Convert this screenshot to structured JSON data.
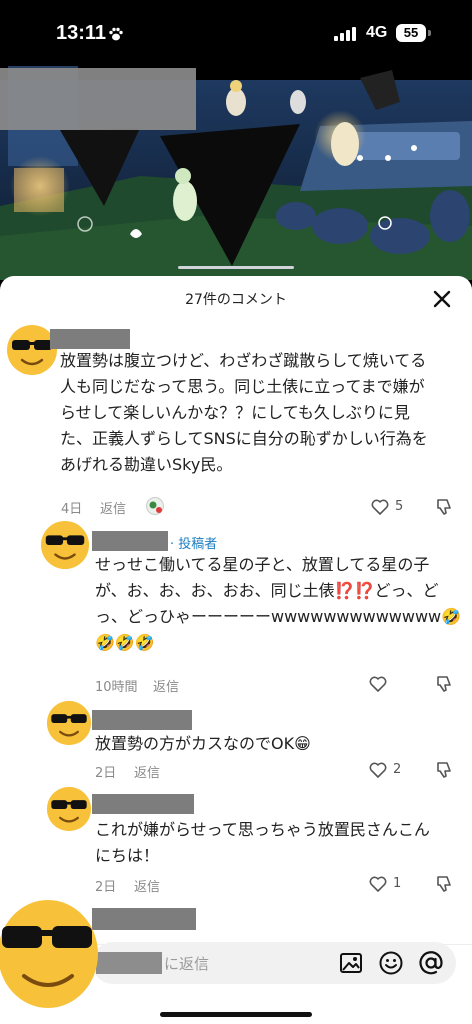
{
  "status": {
    "time": "13:11",
    "network": "4G",
    "battery": "55"
  },
  "sheet": {
    "title": "27件のコメント"
  },
  "comments": [
    {
      "text_lines": [
        "放置勢は腹立つけど、わざわざ蹴散らして焼いてる",
        "人も同じだなって思う。同じ土俵に立ってまで嫌が",
        "らせして楽しいんかな？？にしても久しぶりに見",
        "た、正義人ずらしてSNSに自分の恥ずかしい行為を",
        "あげれる勘違いSky民。"
      ],
      "time": "4日",
      "reply": "返信",
      "likes": "5"
    },
    {
      "author_tag": "· 投稿者",
      "text_lines": [
        "せっせこ働いてる星の子と、放置してる星の子",
        "が、お、お、お、おお、同じ土俵⁉️⁉️どっ、ど",
        "っ、どっひゃーーーーーwwwwwwwwwwwww🤣",
        "🤣🤣🤣"
      ],
      "time": "10時間",
      "reply": "返信",
      "likes": ""
    },
    {
      "text_lines": [
        "放置勢の方がカスなのでOK😁"
      ],
      "time": "2日",
      "reply": "返信",
      "likes": "2"
    },
    {
      "text_lines": [
        "これが嫌がらせって思っちゃう放置民さんこん",
        "にちは！"
      ],
      "time": "2日",
      "reply": "返信",
      "likes": "1"
    }
  ],
  "input": {
    "placeholder": "に返信"
  },
  "icons": {
    "close": "close-icon",
    "like": "heart-icon",
    "dislike": "dislike-icon",
    "image": "image-icon",
    "emoji": "emoji-icon",
    "mention": "at-icon"
  },
  "colors": {
    "author_tag": "#1e7fc1",
    "sheet_bg": "#ffffff",
    "avatar_face": "#f7c23a"
  }
}
